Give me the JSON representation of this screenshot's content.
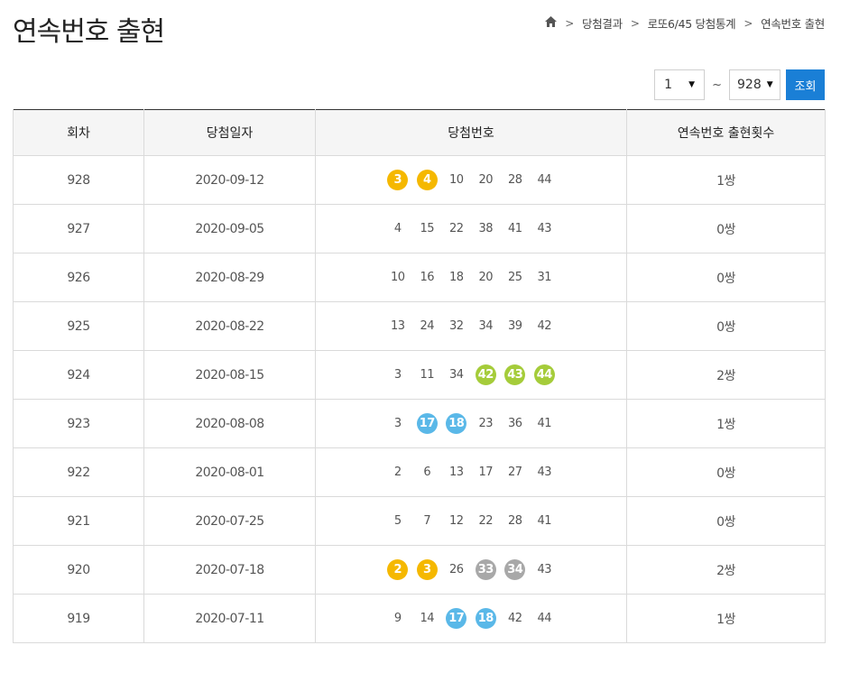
{
  "page": {
    "title": "연속번호 출현"
  },
  "breadcrumb": {
    "home_icon": "home-icon",
    "items": [
      "당첨결과",
      "로또6/45 당첨통계",
      "연속번호 출현"
    ]
  },
  "filter": {
    "from_value": "1",
    "to_value": "928",
    "separator": "~",
    "search_label": "조회",
    "accent_color": "#1a7fd6"
  },
  "table": {
    "headers": [
      "회차",
      "당첨일자",
      "당첨번호",
      "연속번호 출현횟수"
    ],
    "rows": [
      {
        "round": "928",
        "date": "2020-09-12",
        "numbers": [
          "3",
          "4",
          "10",
          "20",
          "28",
          "44"
        ],
        "highlight": [
          "#f5b800",
          "#f5b800",
          "",
          "",
          "",
          ""
        ],
        "count": "1쌍"
      },
      {
        "round": "927",
        "date": "2020-09-05",
        "numbers": [
          "4",
          "15",
          "22",
          "38",
          "41",
          "43"
        ],
        "highlight": [
          "",
          "",
          "",
          "",
          "",
          ""
        ],
        "count": "0쌍"
      },
      {
        "round": "926",
        "date": "2020-08-29",
        "numbers": [
          "10",
          "16",
          "18",
          "20",
          "25",
          "31"
        ],
        "highlight": [
          "",
          "",
          "",
          "",
          "",
          ""
        ],
        "count": "0쌍"
      },
      {
        "round": "925",
        "date": "2020-08-22",
        "numbers": [
          "13",
          "24",
          "32",
          "34",
          "39",
          "42"
        ],
        "highlight": [
          "",
          "",
          "",
          "",
          "",
          ""
        ],
        "count": "0쌍"
      },
      {
        "round": "924",
        "date": "2020-08-15",
        "numbers": [
          "3",
          "11",
          "34",
          "42",
          "43",
          "44"
        ],
        "highlight": [
          "",
          "",
          "",
          "#a5cc3a",
          "#a5cc3a",
          "#a5cc3a"
        ],
        "count": "2쌍"
      },
      {
        "round": "923",
        "date": "2020-08-08",
        "numbers": [
          "3",
          "17",
          "18",
          "23",
          "36",
          "41"
        ],
        "highlight": [
          "",
          "#5ab8e8",
          "#5ab8e8",
          "",
          "",
          ""
        ],
        "count": "1쌍"
      },
      {
        "round": "922",
        "date": "2020-08-01",
        "numbers": [
          "2",
          "6",
          "13",
          "17",
          "27",
          "43"
        ],
        "highlight": [
          "",
          "",
          "",
          "",
          "",
          ""
        ],
        "count": "0쌍"
      },
      {
        "round": "921",
        "date": "2020-07-25",
        "numbers": [
          "5",
          "7",
          "12",
          "22",
          "28",
          "41"
        ],
        "highlight": [
          "",
          "",
          "",
          "",
          "",
          ""
        ],
        "count": "0쌍"
      },
      {
        "round": "920",
        "date": "2020-07-18",
        "numbers": [
          "2",
          "3",
          "26",
          "33",
          "34",
          "43"
        ],
        "highlight": [
          "#f5b800",
          "#f5b800",
          "",
          "#a8a8a8",
          "#a8a8a8",
          ""
        ],
        "count": "2쌍"
      },
      {
        "round": "919",
        "date": "2020-07-11",
        "numbers": [
          "9",
          "14",
          "17",
          "18",
          "42",
          "44"
        ],
        "highlight": [
          "",
          "",
          "#5ab8e8",
          "#5ab8e8",
          "",
          ""
        ],
        "count": "1쌍"
      }
    ]
  }
}
